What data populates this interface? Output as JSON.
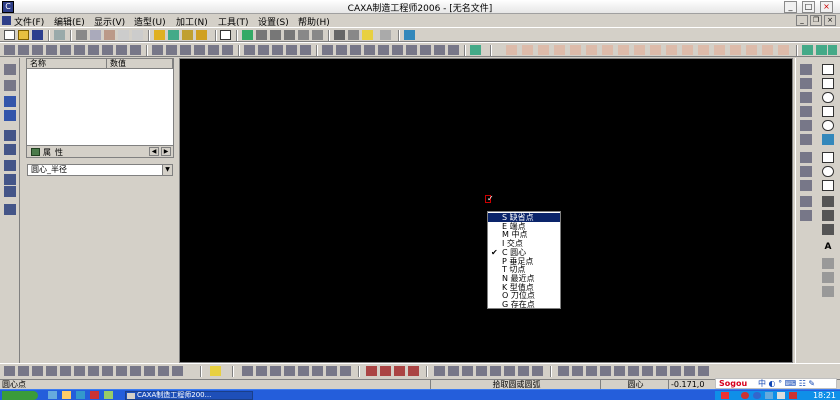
{
  "window": {
    "title": "CAXA制造工程师2006 - [无名文件]",
    "icon_name": "caxa-app-icon",
    "controls": [
      "_",
      "□",
      "×"
    ]
  },
  "menu": {
    "items": [
      "文件(F)",
      "编辑(E)",
      "显示(V)",
      "造型(U)",
      "加工(N)",
      "工具(T)",
      "设置(S)",
      "帮助(H)"
    ]
  },
  "property_panel": {
    "col_name": "名称",
    "col_value": "数值",
    "tab_label": "属性"
  },
  "mode_select": {
    "value": "圆心_半径"
  },
  "point_menu": {
    "items": [
      {
        "label": "S 缺省点",
        "selected": true,
        "checked": false
      },
      {
        "label": "E 端点",
        "selected": false,
        "checked": false
      },
      {
        "label": "M 中点",
        "selected": false,
        "checked": false
      },
      {
        "label": "I 交点",
        "selected": false,
        "checked": false
      },
      {
        "label": "C 圆心",
        "selected": false,
        "checked": true
      },
      {
        "label": "P 垂足点",
        "selected": false,
        "checked": false
      },
      {
        "label": "T 切点",
        "selected": false,
        "checked": false
      },
      {
        "label": "N 最近点",
        "selected": false,
        "checked": false
      },
      {
        "label": "K 型值点",
        "selected": false,
        "checked": false
      },
      {
        "label": "O 刀位点",
        "selected": false,
        "checked": false
      },
      {
        "label": "G 存在点",
        "selected": false,
        "checked": false
      }
    ]
  },
  "status": {
    "prompt": "圆心点",
    "command": "拾取圆或圆弧",
    "point_mode": "圆心",
    "coord": "-0.171,0"
  },
  "ime": {
    "logo": "Sogou",
    "items": "中 ◐ ° ⌨ ☷ ✎"
  },
  "taskbar": {
    "task": "CAXA制造工程师200...",
    "clock": "18:21"
  },
  "colors": {
    "canvas": "#000000",
    "menu_highlight": "#0a246a",
    "taskbar": "#245edb"
  }
}
